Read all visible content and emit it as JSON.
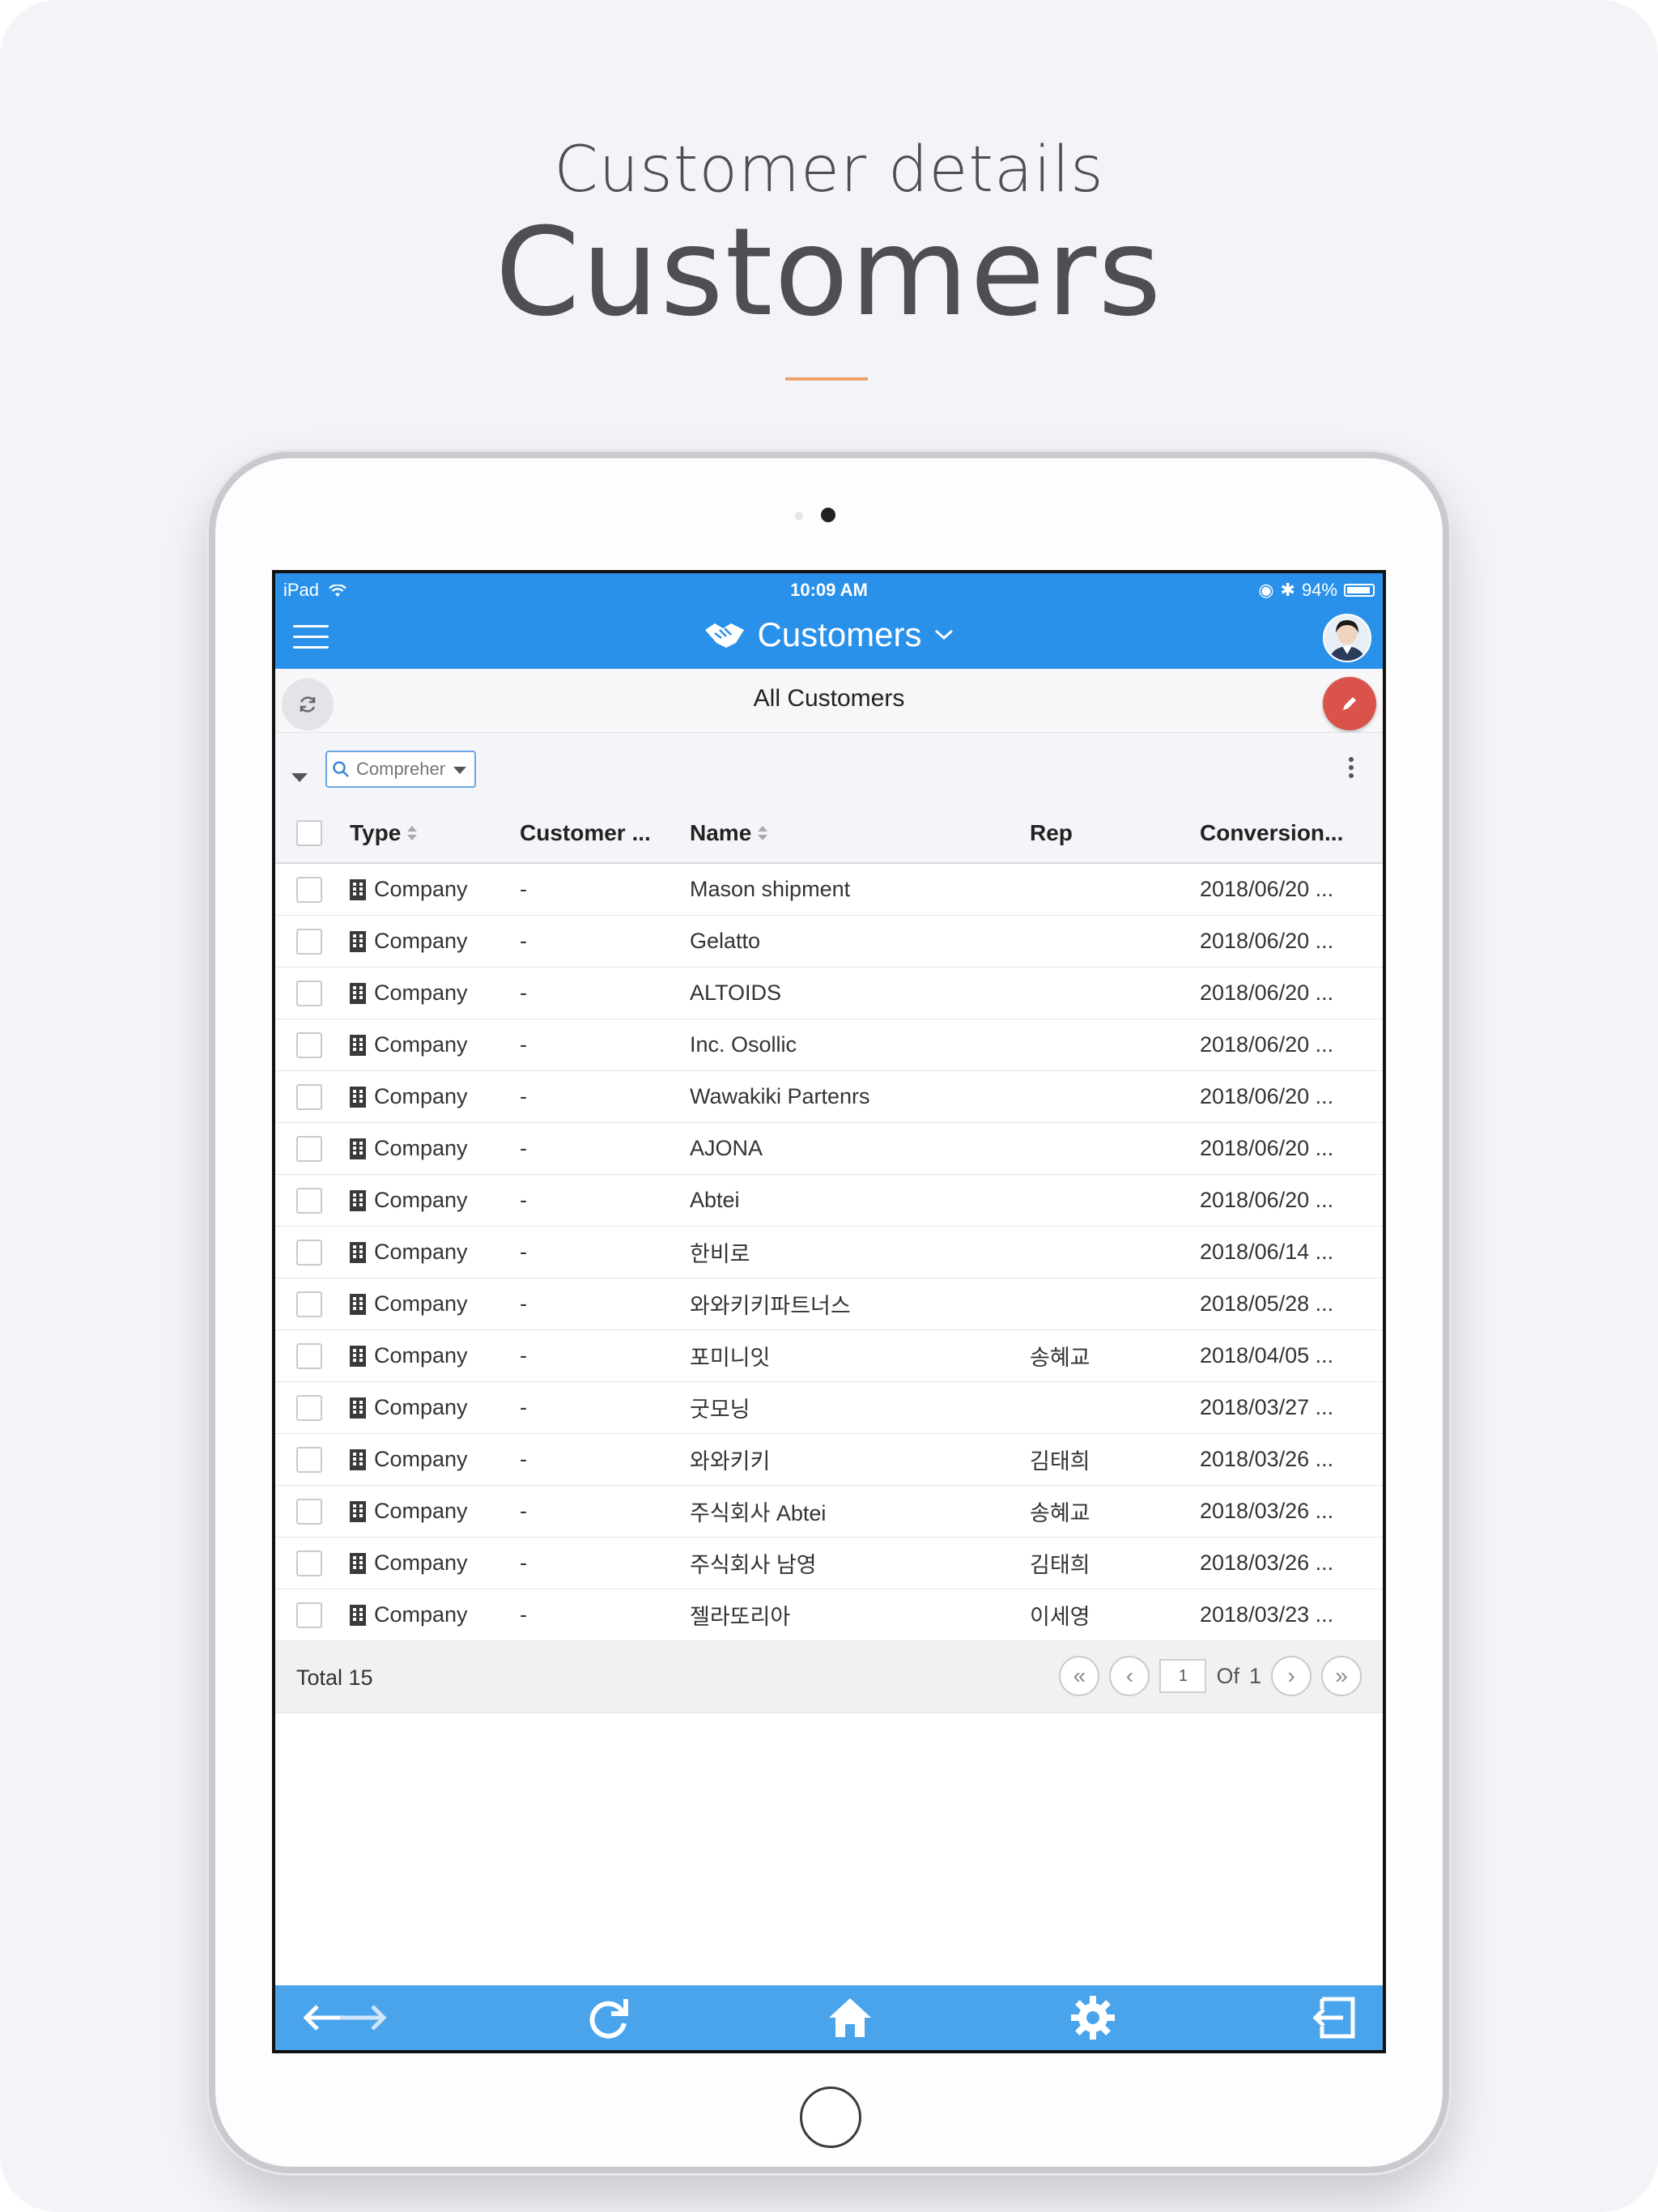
{
  "promo": {
    "subtitle": "Customer details",
    "title": "Customers"
  },
  "status_bar": {
    "device": "iPad",
    "time": "10:09 AM",
    "battery": "94%",
    "battery_level": 0.94
  },
  "nav": {
    "title": "Customers"
  },
  "subheader": {
    "title": "All Customers"
  },
  "filter": {
    "search_placeholder": "Comprehensive"
  },
  "table": {
    "columns": [
      "Type",
      "Customer ...",
      "Name",
      "Rep",
      "Conversion..."
    ],
    "rows": [
      {
        "type": "Company",
        "customer": "-",
        "name": "Mason shipment",
        "rep": "",
        "conversion": "2018/06/20 ..."
      },
      {
        "type": "Company",
        "customer": "-",
        "name": "Gelatto",
        "rep": "",
        "conversion": "2018/06/20 ..."
      },
      {
        "type": "Company",
        "customer": "-",
        "name": "ALTOIDS",
        "rep": "",
        "conversion": "2018/06/20 ..."
      },
      {
        "type": "Company",
        "customer": "-",
        "name": "Inc. Osollic",
        "rep": "",
        "conversion": "2018/06/20 ..."
      },
      {
        "type": "Company",
        "customer": "-",
        "name": "Wawakiki Partenrs",
        "rep": "",
        "conversion": "2018/06/20 ..."
      },
      {
        "type": "Company",
        "customer": "-",
        "name": "AJONA",
        "rep": "",
        "conversion": "2018/06/20 ..."
      },
      {
        "type": "Company",
        "customer": "-",
        "name": "Abtei",
        "rep": "",
        "conversion": "2018/06/20 ..."
      },
      {
        "type": "Company",
        "customer": "-",
        "name": "한비로",
        "rep": "",
        "conversion": "2018/06/14 ..."
      },
      {
        "type": "Company",
        "customer": "-",
        "name": "와와키키파트너스",
        "rep": "",
        "conversion": "2018/05/28 ..."
      },
      {
        "type": "Company",
        "customer": "-",
        "name": "포미니잇",
        "rep": "송혜교",
        "conversion": "2018/04/05 ..."
      },
      {
        "type": "Company",
        "customer": "-",
        "name": "굿모닝",
        "rep": "",
        "conversion": "2018/03/27 ..."
      },
      {
        "type": "Company",
        "customer": "-",
        "name": "와와키키",
        "rep": "김태희",
        "conversion": "2018/03/26 ..."
      },
      {
        "type": "Company",
        "customer": "-",
        "name": "주식회사 Abtei",
        "rep": "송혜교",
        "conversion": "2018/03/26 ..."
      },
      {
        "type": "Company",
        "customer": "-",
        "name": "주식회사 남영",
        "rep": "김태희",
        "conversion": "2018/03/26 ..."
      },
      {
        "type": "Company",
        "customer": "-",
        "name": "젤라또리아",
        "rep": "이세영",
        "conversion": "2018/03/23 ..."
      }
    ]
  },
  "pagination": {
    "total_label": "Total 15",
    "current_page": "1",
    "of_label": "Of",
    "total_pages": "1"
  },
  "colors": {
    "primary": "#2a91ea",
    "bottom_bar": "#4aa4ec",
    "edit_fab": "#d9534a",
    "accent_rule": "#f0a26a"
  },
  "icons": {
    "menu": "hamburger-icon",
    "brand": "handshake-icon",
    "refresh": "refresh-icon",
    "edit": "pencil-icon",
    "building": "building-icon",
    "bottom_nav": [
      "back-forward-icon",
      "reload-icon",
      "home-icon",
      "settings-icon",
      "logout-icon"
    ]
  }
}
